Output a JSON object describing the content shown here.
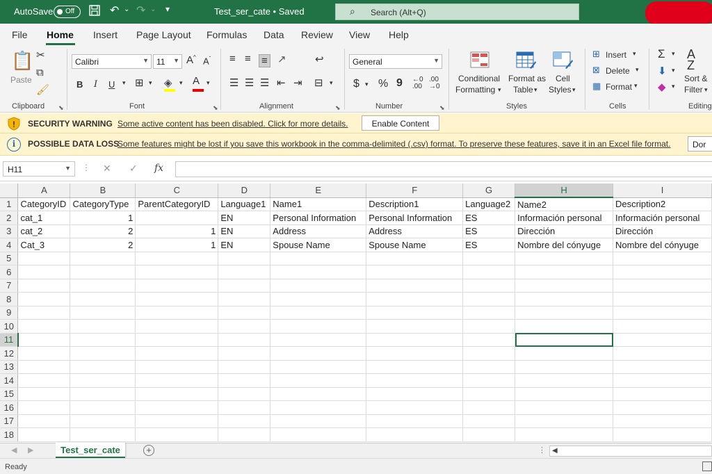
{
  "titlebar": {
    "autosave_label": "AutoSave",
    "autosave_state": "Off",
    "doc_title": "Test_ser_cate • Saved",
    "search_placeholder": "Search (Alt+Q)"
  },
  "menu": {
    "tabs": [
      "File",
      "Home",
      "Insert",
      "Page Layout",
      "Formulas",
      "Data",
      "Review",
      "View",
      "Help"
    ],
    "active": "Home"
  },
  "ribbon": {
    "clipboard": {
      "paste": "Paste",
      "label": "Clipboard"
    },
    "font": {
      "name": "Calibri",
      "size": "11",
      "label": "Font",
      "bold": "B",
      "italic": "I",
      "underline": "U"
    },
    "alignment": {
      "label": "Alignment"
    },
    "number": {
      "format": "General",
      "label": "Number",
      "currency": "$",
      "percent": "%",
      "comma": "9"
    },
    "styles": {
      "conditional_1": "Conditional",
      "conditional_2": "Formatting",
      "format_table_1": "Format as",
      "format_table_2": "Table",
      "cell_styles_1": "Cell",
      "cell_styles_2": "Styles",
      "label": "Styles"
    },
    "cells": {
      "insert": "Insert",
      "delete": "Delete",
      "format": "Format",
      "label": "Cells"
    },
    "editing": {
      "sort_1": "Sort &",
      "sort_2": "Filter",
      "label": "Editing"
    }
  },
  "security_bar": {
    "title": "SECURITY WARNING",
    "message": "Some active content has been disabled. Click for more details.",
    "button": "Enable Content"
  },
  "dataloss_bar": {
    "title": "POSSIBLE DATA LOSS",
    "message": "Some features might be lost if you save this workbook in the comma-delimited (.csv) format. To preserve these features, save it in an Excel file format.",
    "button": "Dor"
  },
  "formula_bar": {
    "name_box": "H11",
    "fx": "fx",
    "value": ""
  },
  "sheet": {
    "columns": [
      "A",
      "B",
      "C",
      "D",
      "E",
      "F",
      "G",
      "H",
      "I"
    ],
    "selected_column": "H",
    "selected_row": "11",
    "header_row": [
      "CategoryID",
      "CategoryType",
      "ParentCategoryID",
      "Language1",
      "Name1",
      "Description1",
      "Language2",
      "Name2",
      "Description2"
    ],
    "rows": [
      [
        "cat_1",
        "1",
        "",
        "EN",
        "Personal Information",
        "Personal Information",
        "ES",
        "Información personal",
        "Información personal"
      ],
      [
        "cat_2",
        "2",
        "1",
        "EN",
        "Address",
        "Address",
        "ES",
        "Dirección",
        "Dirección"
      ],
      [
        "Cat_3",
        "2",
        "1",
        "EN",
        "Spouse Name",
        "Spouse Name",
        "ES",
        "Nombre del cónyuge",
        "Nombre del cónyuge"
      ]
    ],
    "row_numbers": [
      "1",
      "2",
      "3",
      "4",
      "5",
      "6",
      "7",
      "8",
      "9",
      "10",
      "11",
      "12",
      "13",
      "14",
      "15",
      "16",
      "17",
      "18"
    ]
  },
  "sheet_tabs": {
    "active": "Test_ser_cate",
    "add": "+"
  },
  "status": {
    "ready": "Ready"
  },
  "colors": {
    "brand": "#217346",
    "warning_bg": "#fff4ce"
  }
}
